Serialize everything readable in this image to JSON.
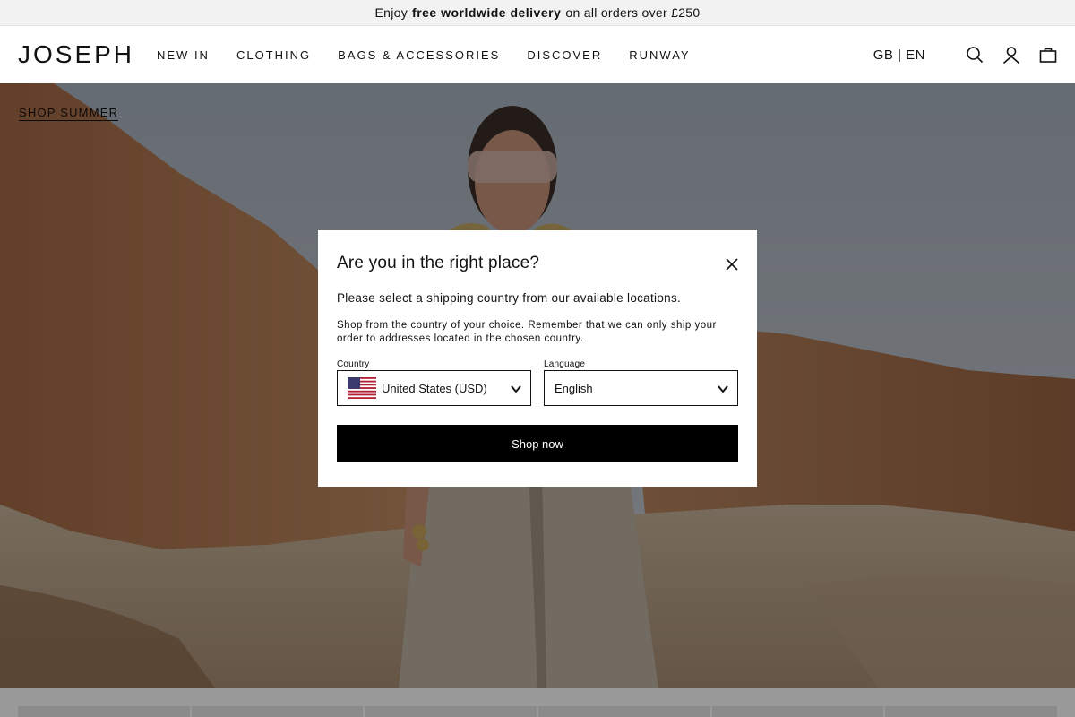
{
  "promo": {
    "prefix": "Enjoy",
    "highlight": "free worldwide delivery",
    "suffix": "on all orders over £250"
  },
  "header": {
    "logo": "JOSEPH",
    "nav": [
      "NEW IN",
      "CLOTHING",
      "BAGS & ACCESSORIES",
      "DISCOVER",
      "RUNWAY"
    ],
    "locale": "GB | EN",
    "icons": [
      "search-icon",
      "account-icon",
      "bag-icon"
    ]
  },
  "hero": {
    "link_label": "SHOP SUMMER"
  },
  "modal": {
    "title": "Are you in the right place?",
    "subtitle": "Please select a shipping country from our available locations.",
    "description": "Shop from the country of your choice. Remember that we can only ship your order to addresses located in the chosen country.",
    "country_label": "Country",
    "country_value": "United States (USD)",
    "language_label": "Language",
    "language_value": "English",
    "cta": "Shop now"
  },
  "colors": {
    "primary": "#000000",
    "overlay": "rgba(0,0,0,0.40)",
    "promo_bg": "#f2f2f2"
  }
}
